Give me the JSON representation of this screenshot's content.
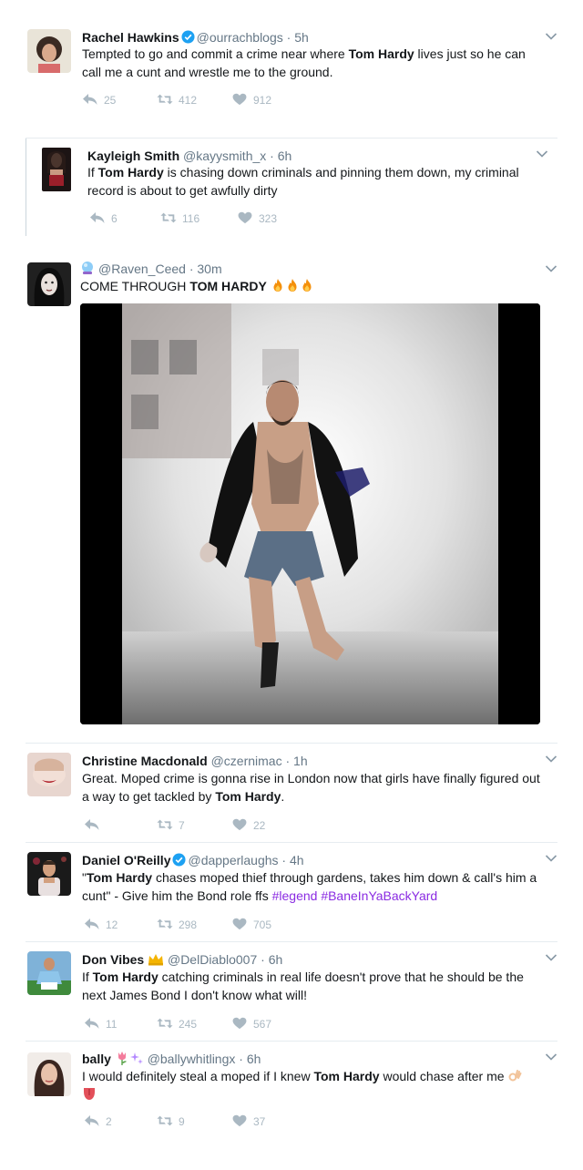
{
  "tweets": [
    {
      "name": "Rachel Hawkins",
      "handle": "@ourrachblogs",
      "time": "5h",
      "verified": true,
      "text_parts": [
        "Tempted to go and commit a crime near where ",
        "Tom Hardy",
        " lives just so he can call me a cunt and wrestle me to the ground."
      ],
      "replies": "25",
      "retweets": "412",
      "likes": "912"
    },
    {
      "name": "Kayleigh Smith",
      "handle": "@kayysmith_x",
      "time": "6h",
      "text_parts": [
        "If ",
        "Tom Hardy",
        " is chasing down criminals and pinning them down, my criminal record is about to get awfully dirty"
      ],
      "replies": "6",
      "retweets": "116",
      "likes": "323"
    },
    {
      "name": "",
      "handle": "@Raven_Ceed",
      "time": "30m",
      "text_parts": [
        "COME THROUGH ",
        "TOM HARDY"
      ],
      "emoji_count": 3
    },
    {
      "name": "Christine Macdonald",
      "handle": "@czernimac",
      "time": "1h",
      "text_parts": [
        "Great. Moped crime is gonna rise in London now that girls have finally figured out a way to get tackled by ",
        "Tom Hardy",
        "."
      ],
      "replies": "",
      "retweets": "7",
      "likes": "22"
    },
    {
      "name": "Daniel O'Reilly",
      "handle": "@dapperlaughs",
      "time": "4h",
      "verified": true,
      "text_parts": [
        "\"",
        "Tom Hardy",
        " chases moped thief through gardens, takes him down & call's him a cunt\" - Give him the Bond role ffs "
      ],
      "hashtags": [
        "#legend",
        "#BaneInYaBackYard"
      ],
      "replies": "12",
      "retweets": "298",
      "likes": "705"
    },
    {
      "name": "Don Vibes",
      "handle": "@DelDiablo007",
      "time": "6h",
      "text_parts": [
        "If ",
        "Tom Hardy",
        " catching criminals in real life doesn't prove that he should be the next James Bond I don't know what will!"
      ],
      "replies": "11",
      "retweets": "245",
      "likes": "567"
    },
    {
      "name": "bally",
      "handle": "@ballywhitlingx",
      "time": "6h",
      "text_parts": [
        "I would definitely steal a moped if I knew ",
        "Tom Hardy",
        " would chase after me"
      ],
      "replies": "2",
      "retweets": "9",
      "likes": "37"
    }
  ],
  "colors": {
    "name": "#14171a",
    "meta": "#657786",
    "action": "#aab8c2",
    "verified": "#1da1f2",
    "hashtag": "#8a2be2",
    "divider": "#e6ecf0"
  },
  "icons": [
    "reply-icon",
    "retweet-icon",
    "like-icon",
    "verified-badge-icon",
    "chevron-down-icon",
    "fire-emoji",
    "crown-emoji",
    "tulip-emoji",
    "sparkles-emoji",
    "ok-hand-emoji",
    "tongue-emoji"
  ]
}
